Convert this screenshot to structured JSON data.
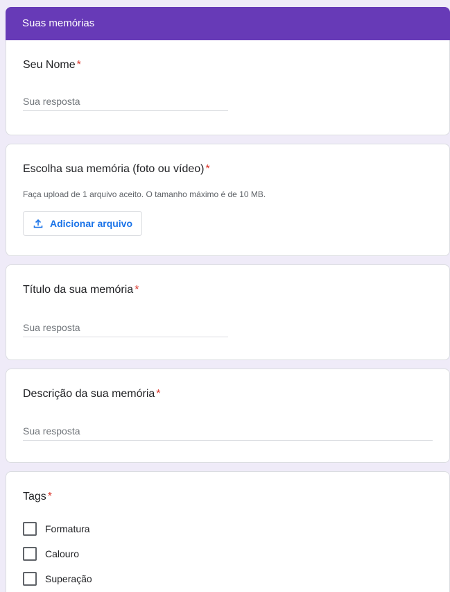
{
  "header": {
    "title": "Suas memórias"
  },
  "required_mark": "*",
  "questions": {
    "name": {
      "label": "Seu Nome",
      "placeholder": "Sua resposta"
    },
    "memory": {
      "label": "Escolha sua memória (foto ou vídeo)",
      "help": "Faça upload de 1 arquivo aceito. O tamanho máximo é de 10 MB.",
      "button_label": "Adicionar arquivo",
      "button_icon": "upload-icon"
    },
    "title": {
      "label": "Título da sua memória",
      "placeholder": "Sua resposta"
    },
    "description": {
      "label": "Descrição da sua memória",
      "placeholder": "Sua resposta"
    },
    "tags": {
      "label": "Tags",
      "options": [
        "Formatura",
        "Calouro",
        "Superação"
      ]
    }
  },
  "colors": {
    "header": "#673ab7",
    "background": "#efebf8",
    "required": "#d93025",
    "link": "#1a73e8"
  }
}
